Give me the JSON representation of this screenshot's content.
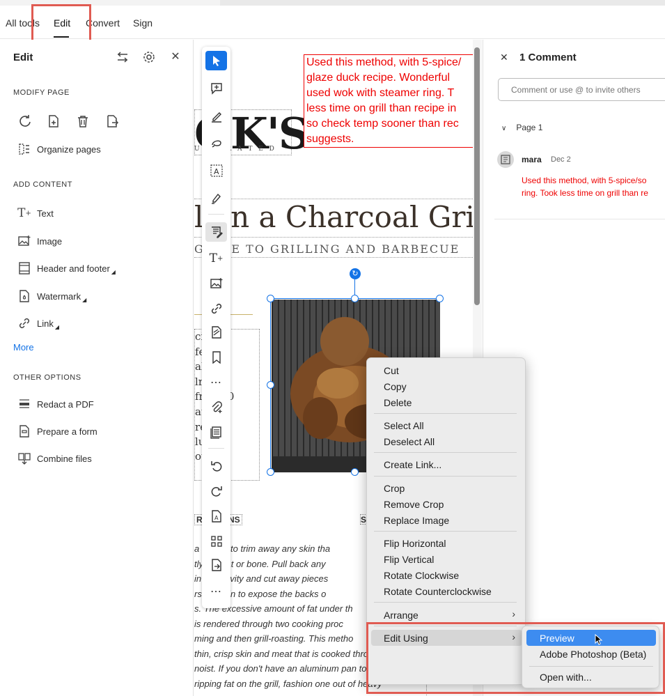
{
  "tabs": [
    {
      "label": "All tools"
    },
    {
      "label": "Edit"
    },
    {
      "label": "Convert"
    },
    {
      "label": "Sign"
    }
  ],
  "left_panel": {
    "title": "Edit",
    "modify_page_label": "MODIFY PAGE",
    "organize_pages": "Organize pages",
    "add_content_label": "ADD CONTENT",
    "add_content_items": [
      "Text",
      "Image",
      "Header and footer",
      "Watermark",
      "Link"
    ],
    "more": "More",
    "other_options_label": "OTHER OPTIONS",
    "other_items": [
      "Redact a PDF",
      "Prepare a form",
      "Combine files"
    ]
  },
  "document": {
    "logo": "OK'S",
    "logo_sub": "U S T R A T E D",
    "title": "l on a Charcoal Grill",
    "subtitle": "GUIDE TO GRILLING AND BARBECUE",
    "sticky_lines": [
      "Used this method, with 5-spice/",
      "glaze duck recipe.  Wonderful",
      "used wok with steamer ring.  T",
      "less time on grill than recipe in",
      "so check temp sooner than rec",
      "suggests."
    ],
    "side_lines": [
      "ci    e",
      "fe    it to",
      "al    ng",
      "lry",
      "fr    to 30",
      "at",
      "re    the",
      "lu",
      "ou    -"
    ],
    "instructions_label": "RUCTIONS",
    "s_label": "S",
    "body_lines": [
      "a s   knife to trim away any skin tha",
      "tly   e meat or bone. Pull back any",
      "in   eck cavity and cut away pieces",
      "rs   the skin to expose the backs o",
      "s. The excessive amount of fat under th",
      "is rendered through two cooking proc",
      "ming and then grill-roasting. This metho",
      "thin, crisp skin and meat that is cooked through but",
      "noist. If you don't have an aluminum pan to catch",
      "ripping fat on the grill, fashion one out of heavy-"
    ]
  },
  "comments": {
    "title": "1 Comment",
    "input_placeholder": "Comment or use @ to invite others",
    "page_label": "Page 1",
    "user": "mara",
    "date": "Dec 2",
    "comment_lines": [
      "Used this method, with 5-spice/so",
      "ring.  Took less time on grill than re"
    ]
  },
  "context_menu": {
    "items": [
      [
        "Cut",
        "Copy",
        "Delete"
      ],
      [
        "Select All",
        "Deselect All"
      ],
      [
        "Create Link..."
      ],
      [
        "Crop",
        "Remove Crop",
        "Replace Image"
      ],
      [
        "Flip Horizontal",
        "Flip Vertical",
        "Rotate Clockwise",
        "Rotate Counterclockwise"
      ],
      [
        "Arrange"
      ],
      [
        "Edit Using"
      ]
    ],
    "submenu_arrow": "›"
  },
  "submenu": {
    "items": [
      "Preview",
      "Adobe Photoshop (Beta)",
      "Open with..."
    ]
  },
  "colors": {
    "accent": "#1473e6",
    "highlight_box": "#e05b52",
    "comment_red": "#ee0000"
  }
}
